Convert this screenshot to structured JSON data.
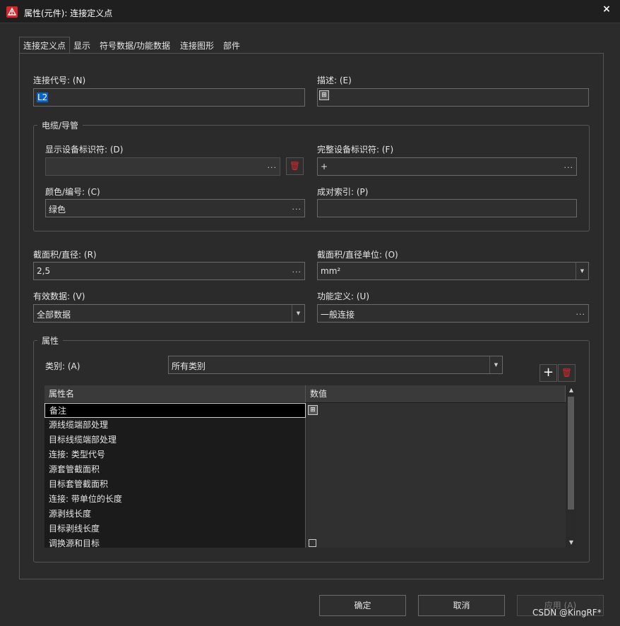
{
  "window": {
    "title": "属性(元件): 连接定义点",
    "close": "×"
  },
  "tabs": [
    "连接定义点",
    "显示",
    "符号数据/功能数据",
    "连接图形",
    "部件"
  ],
  "fields": {
    "connection_code": {
      "label": "连接代号: (N)",
      "value": "L2"
    },
    "description": {
      "label": "描述: (E)",
      "value": ""
    },
    "cable_group": "电缆/导管",
    "display_device_tag": {
      "label": "显示设备标识符: (D)",
      "value": ""
    },
    "full_device_tag": {
      "label": "完整设备标识符: (F)",
      "value": "+"
    },
    "color_number": {
      "label": "颜色/编号: (C)",
      "value": "绿色"
    },
    "pair_index": {
      "label": "成对索引: (P)",
      "value": ""
    },
    "cross_section": {
      "label": "截面积/直径: (R)",
      "value": "2,5"
    },
    "cross_section_unit": {
      "label": "截面积/直径单位: (O)",
      "value": "mm²"
    },
    "valid_data": {
      "label": "有效数据: (V)",
      "value": "全部数据"
    },
    "function_def": {
      "label": "功能定义: (U)",
      "value": "一般连接"
    }
  },
  "properties": {
    "group_title": "属性",
    "category_label": "类别: (A)",
    "category_value": "所有类别",
    "headers": [
      "属性名",
      "数值"
    ],
    "rows": [
      "备注",
      "源线缆端部处理",
      "目标线缆端部处理",
      "连接: 类型代号",
      "源套管截面积",
      "目标套管截面积",
      "连接: 带单位的长度",
      "源剥线长度",
      "目标剥线长度",
      "调换源和目标"
    ]
  },
  "buttons": {
    "ok": "确定",
    "cancel": "取消",
    "apply": "应用 (A)"
  },
  "watermark": "CSDN @KingRF*",
  "glyphs": {
    "dots": "...",
    "dropdown": "▼",
    "plus": "+",
    "trash": "🗑",
    "up": "▲",
    "down": "▼"
  },
  "colors": {
    "accent": "#d9262e",
    "selection": "#0a64c8"
  }
}
